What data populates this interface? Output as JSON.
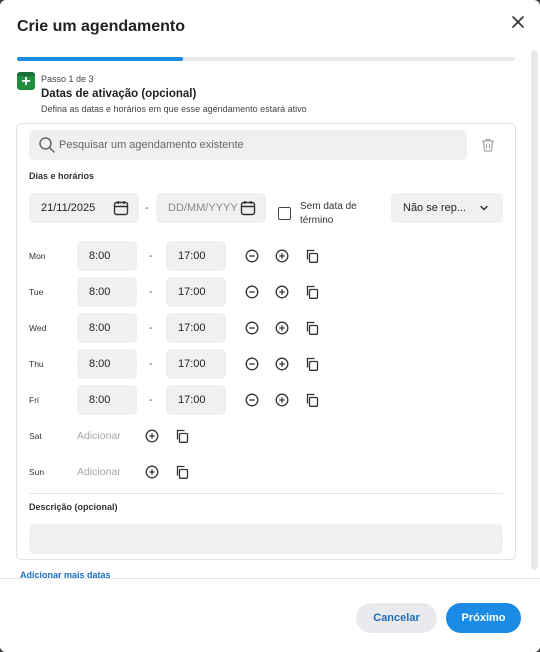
{
  "dialog": {
    "title": "Crie um agendamento",
    "progress_fraction": 0.3333
  },
  "step": {
    "label": "Passo 1 de 3",
    "title": "Datas de ativação (opcional)",
    "description": "Defina as datas e horários em que esse agendamento estará ativo"
  },
  "search": {
    "placeholder": "Pesquisar um agendamento existente"
  },
  "dates": {
    "section_label": "Dias e horários",
    "start_date": "21/11/2025",
    "separator": "-",
    "end_date_placeholder": "DD/MM/YYYY",
    "no_end_label_line1": "Sem data de",
    "no_end_label_line2": "término",
    "no_end_checked": false,
    "repeat_value": "Não se rep..."
  },
  "days": [
    {
      "name": "Mon",
      "start": "8:00",
      "sep": "-",
      "end": "17:00"
    },
    {
      "name": "Tue",
      "start": "8:00",
      "sep": "-",
      "end": "17:00"
    },
    {
      "name": "Wed",
      "start": "8:00",
      "sep": "-",
      "end": "17:00"
    },
    {
      "name": "Thu",
      "start": "8:00",
      "sep": "-",
      "end": "17:00"
    },
    {
      "name": "Fri",
      "start": "8:00",
      "sep": "-",
      "end": "17:00"
    },
    {
      "name": "Sat",
      "add_label": "Adicionar"
    },
    {
      "name": "Sun",
      "add_label": "Adicionar"
    }
  ],
  "description": {
    "label": "Descrição (opcional)",
    "value": ""
  },
  "more_dates_link": "Adicionar mais datas",
  "footer": {
    "cancel_label": "Cancelar",
    "next_label": "Próximo"
  },
  "colors": {
    "accent": "#1b8be6",
    "link": "#1b6fc0",
    "step_icon": "#1e8e3e"
  },
  "icons": [
    "close-icon",
    "calendar-add-icon",
    "search-icon",
    "trash-icon",
    "calendar-icon",
    "chevron-down-icon",
    "remove-circle-icon",
    "add-circle-icon",
    "copy-icon"
  ]
}
